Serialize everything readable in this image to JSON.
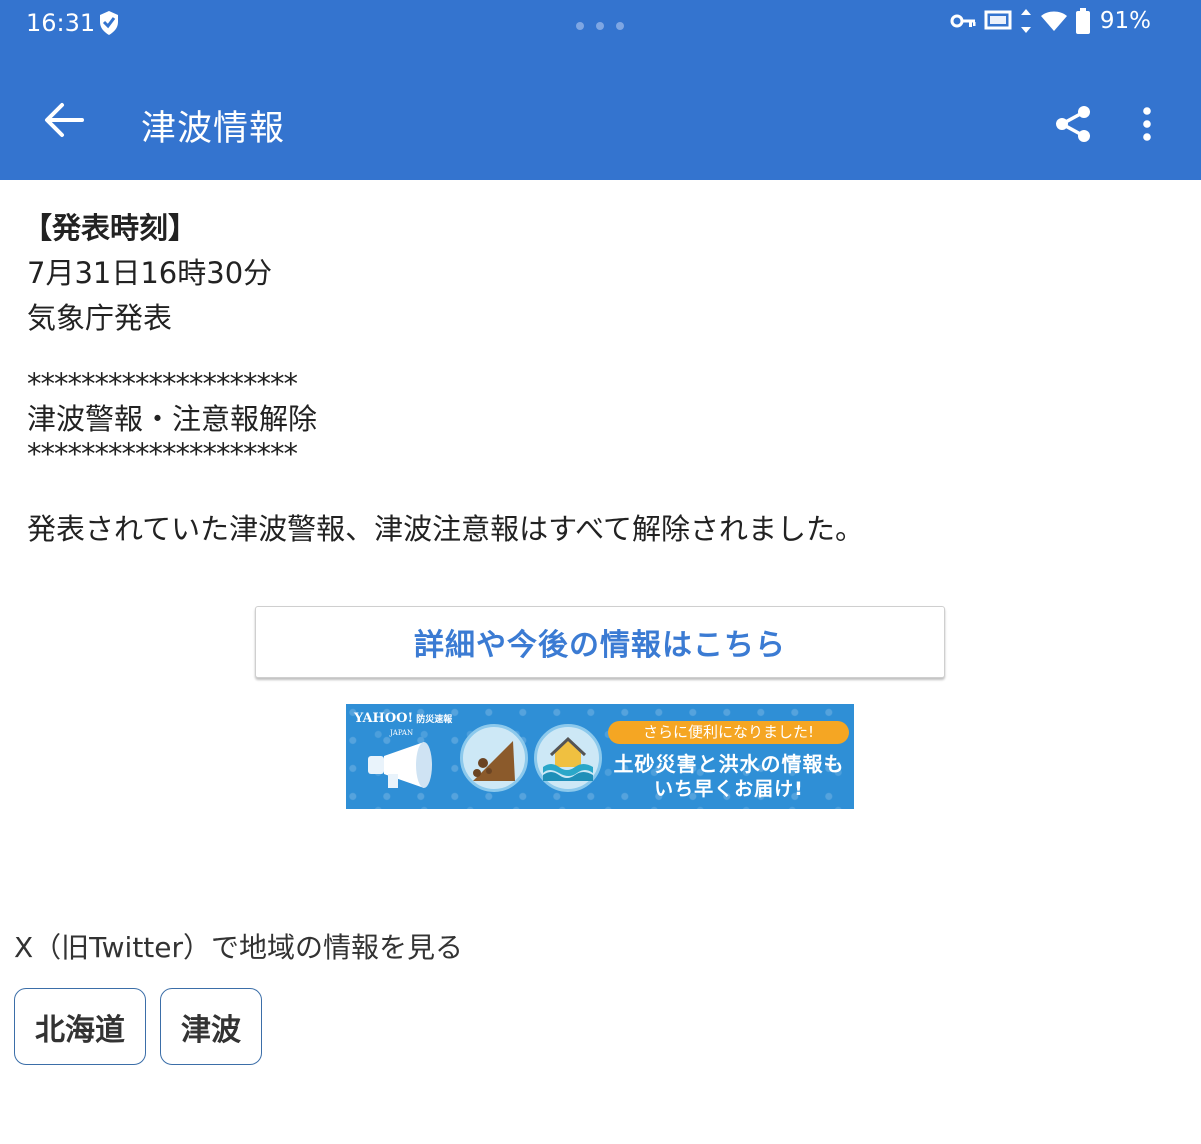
{
  "status_bar": {
    "time": "16:31",
    "battery": "91%",
    "icons": [
      "shield-icon",
      "vpn-key-icon",
      "cast-icon",
      "data-arrows-icon",
      "wifi-icon",
      "battery-icon"
    ]
  },
  "app_bar": {
    "title": "津波情報",
    "icons": [
      "back-arrow-icon",
      "share-icon",
      "more-vert-icon"
    ]
  },
  "bulletin": {
    "heading": "【発表時刻】",
    "datetime": "7月31日16時30分",
    "issuer": "気象庁発表",
    "separator_top": "********************",
    "subject": "津波警報・注意報解除",
    "separator_bottom": "********************",
    "body": "発表されていた津波警報、津波注意報はすべて解除されました。"
  },
  "detail_button": {
    "label": "詳細や今後の情報はこちら"
  },
  "banner": {
    "logo": "YAHOO!",
    "logo_sub": "JAPAN",
    "logo_service": "防災速報",
    "pill": "さらに便利になりました!",
    "line1": "土砂災害と洪水の情報も",
    "line2": "いち早くお届け!"
  },
  "x_section": {
    "label": "X（旧Twitter）で地域の情報を見る",
    "tags": [
      "北海道",
      "津波"
    ]
  },
  "colors": {
    "primary": "#3474cf",
    "link_text": "#3b7bd3",
    "banner_bg": "#2f8fd6",
    "banner_pill": "#f5a623",
    "tag_border": "#3b6ea8"
  }
}
